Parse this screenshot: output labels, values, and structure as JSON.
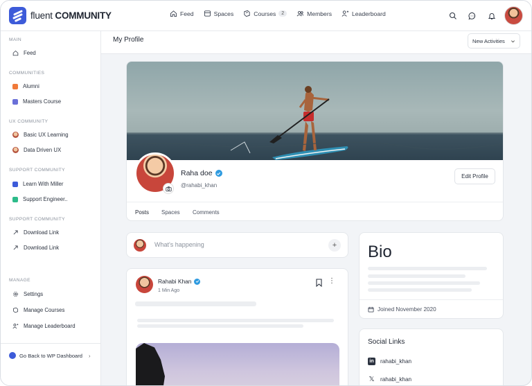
{
  "brand": {
    "name_light": "fluent",
    "name_bold": "COMMUNITY",
    "color": "#3d5bd9"
  },
  "topnav": {
    "items": [
      {
        "label": "Feed",
        "icon": "home-icon"
      },
      {
        "label": "Spaces",
        "icon": "spaces-icon"
      },
      {
        "label": "Courses",
        "icon": "courses-icon",
        "badge": "2"
      },
      {
        "label": "Members",
        "icon": "members-icon"
      },
      {
        "label": "Leaderboard",
        "icon": "leaderboard-icon"
      }
    ],
    "right_icons": [
      "search-icon",
      "chat-icon",
      "bell-icon"
    ]
  },
  "sidebar": {
    "sections": [
      {
        "title": "MAIN"
      },
      {
        "title": "COMMUNITIES"
      },
      {
        "title": "UX COMMUNITY"
      },
      {
        "title": "SUPPORT COMMUNITY"
      },
      {
        "title": "SUPPORT COMMUNITY"
      },
      {
        "title": "MANAGE"
      }
    ],
    "items": [
      {
        "label": "Feed"
      },
      {
        "label": "Alumni",
        "color": "#f07a3a"
      },
      {
        "label": "Masters Course",
        "color": "#6a6fd8"
      },
      {
        "label": "Basic UX Learning"
      },
      {
        "label": "Data Driven UX"
      },
      {
        "label": "Learn With Miller",
        "color": "#3d5bd9"
      },
      {
        "label": "Support Engineer..",
        "color": "#2dbb8a"
      },
      {
        "label": "Download Link"
      },
      {
        "label": "Download Link"
      },
      {
        "label": "Settings"
      },
      {
        "label": "Manage Courses"
      },
      {
        "label": "Manage Leaderboard"
      }
    ],
    "footer": "Go Back to WP Dashboard"
  },
  "page": {
    "title": "My Profile",
    "filter": "New Activities"
  },
  "profile": {
    "name": "Raha doe",
    "handle": "@rahabi_khan",
    "edit_label": "Edit Profile",
    "tabs": [
      "Posts",
      "Spaces",
      "Comments"
    ]
  },
  "composer": {
    "placeholder": "What's happening"
  },
  "post": {
    "author": "Rahabi Khan",
    "time": "1 Min Ago"
  },
  "bio": {
    "title": "Bio",
    "joined": "Joined November 2020"
  },
  "social": {
    "title": "Social Links",
    "links": [
      {
        "network": "linkedin",
        "label": "rahabi_khan"
      },
      {
        "network": "x",
        "label": "rahabi_khan"
      }
    ]
  }
}
